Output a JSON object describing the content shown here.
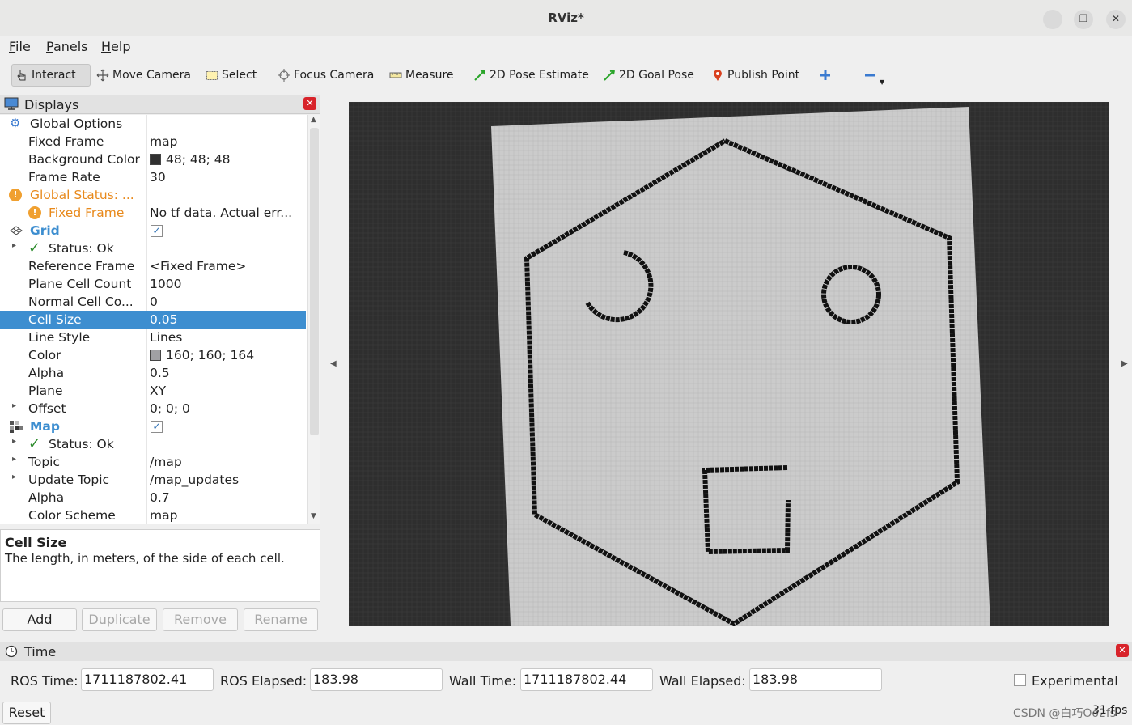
{
  "window": {
    "title": "RViz*"
  },
  "menubar": {
    "items": [
      {
        "underline": "F",
        "rest": "ile"
      },
      {
        "underline": "P",
        "rest": "anels"
      },
      {
        "underline": "H",
        "rest": "elp"
      }
    ]
  },
  "toolbar": {
    "interact": "Interact",
    "move_camera": "Move Camera",
    "select": "Select",
    "focus_camera": "Focus Camera",
    "measure": "Measure",
    "pose_estimate": "2D Pose Estimate",
    "goal_pose": "2D Goal Pose",
    "publish_point": "Publish Point"
  },
  "displays": {
    "title": "Displays",
    "rows": {
      "global_options": "Global Options",
      "fixed_frame": {
        "name": "Fixed Frame",
        "value": "map"
      },
      "background_color": {
        "name": "Background Color",
        "value": "48; 48; 48",
        "swatch": "#303030"
      },
      "frame_rate": {
        "name": "Frame Rate",
        "value": "30"
      },
      "global_status": {
        "name": "Global Status: ..."
      },
      "fixed_frame_err": {
        "name": "Fixed Frame",
        "value": "No tf data.  Actual err..."
      },
      "grid": {
        "name": "Grid",
        "checked": true
      },
      "grid_status": {
        "name": "Status: Ok"
      },
      "reference_frame": {
        "name": "Reference Frame",
        "value": "<Fixed Frame>"
      },
      "plane_cell_count": {
        "name": "Plane Cell Count",
        "value": "1000"
      },
      "normal_cell_count": {
        "name": "Normal Cell Co...",
        "value": "0"
      },
      "cell_size": {
        "name": "Cell Size",
        "value": "0.05",
        "selected": true
      },
      "line_style": {
        "name": "Line Style",
        "value": "Lines"
      },
      "color": {
        "name": "Color",
        "value": "160; 160; 164",
        "swatch": "#a0a0a4"
      },
      "alpha": {
        "name": "Alpha",
        "value": "0.5"
      },
      "plane": {
        "name": "Plane",
        "value": "XY"
      },
      "offset": {
        "name": "Offset",
        "value": "0; 0; 0"
      },
      "map": {
        "name": "Map",
        "checked": true
      },
      "map_status": {
        "name": "Status: Ok"
      },
      "topic": {
        "name": "Topic",
        "value": "/map"
      },
      "update_topic": {
        "name": "Update Topic",
        "value": "/map_updates"
      },
      "map_alpha": {
        "name": "Alpha",
        "value": "0.7"
      },
      "color_scheme": {
        "name": "Color Scheme",
        "value": "map"
      }
    },
    "description": {
      "title": "Cell Size",
      "text": "The length, in meters, of the side of each cell."
    },
    "buttons": {
      "add": "Add",
      "duplicate": "Duplicate",
      "remove": "Remove",
      "rename": "Rename"
    }
  },
  "time": {
    "title": "Time",
    "ros_time_label": "ROS Time:",
    "ros_time": "1711187802.41",
    "ros_elapsed_label": "ROS Elapsed:",
    "ros_elapsed": "183.98",
    "wall_time_label": "Wall Time:",
    "wall_time": "1711187802.44",
    "wall_elapsed_label": "Wall Elapsed:",
    "wall_elapsed": "183.98",
    "experimental": "Experimental",
    "reset": "Reset",
    "fps": "31 fps"
  },
  "watermark": "CSDN @白巧Oo2fs",
  "colors": {
    "selection": "#3d8ed0",
    "warning": "#e8891b",
    "viewport_bg": "#303030",
    "map_free": "#c9c9c9",
    "map_wall": "#111111"
  }
}
